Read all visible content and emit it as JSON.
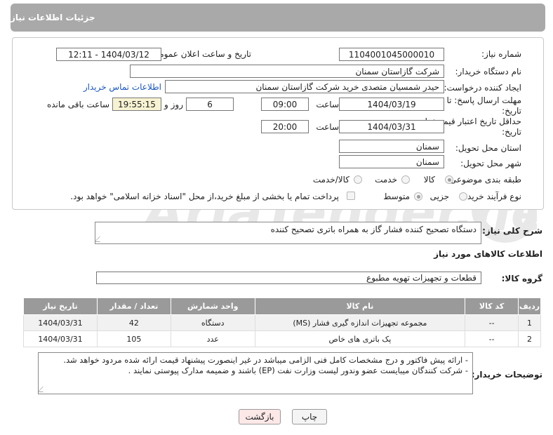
{
  "header": {
    "title": "جزئیات اطلاعات نیاز"
  },
  "form": {
    "need_number_label": "شماره نیاز:",
    "need_number": "1104001045000010",
    "announce_label": "تاریخ و ساعت اعلان عمومی:",
    "announce_value": "1404/03/12 - 12:11",
    "buyer_org_label": "نام دستگاه خریدار:",
    "buyer_org": "شرکت گازاستان سمنان",
    "requester_label": "ایجاد کننده درخواست:",
    "requester": "حیدر شمسیان متصدی خرید شرکت گازاستان سمنان",
    "contact_link": "اطلاعات تماس خریدار",
    "send_deadline_label": "مهلت ارسال پاسخ: تا تاریخ:",
    "send_date": "1404/03/19",
    "time_label": "ساعت",
    "send_time": "09:00",
    "days_value": "6",
    "days_label": "روز و",
    "remaining_time": "19:55:15",
    "remaining_label": "ساعت باقی مانده",
    "price_validity_label": "حداقل تاریخ اعتبار قیمت: تا تاریخ:",
    "price_date": "1404/03/31",
    "price_time": "20:00",
    "province_label": "استان محل تحویل:",
    "province": "سمنان",
    "city_label": "شهر محل تحویل:",
    "city": "سمنان",
    "category_label": "طبقه بندی موضوعی:",
    "category_options": [
      "کالا",
      "خدمت",
      "کالا/خدمت"
    ],
    "process_label": "نوع فرآیند خرید :",
    "process_options": [
      "جزیی",
      "متوسط"
    ],
    "payment_note": "پرداخت تمام یا بخشی از مبلغ خرید،از محل \"اسناد خزانه اسلامی\" خواهد بود."
  },
  "description": {
    "label": "شرح کلی نیاز:",
    "text": "دستگاه تصحیح کننده فشار گاز به همراه باتری تصحیح کننده"
  },
  "goods": {
    "section_title": "اطلاعات کالاهای مورد نیاز",
    "group_label": "گروه کالا:",
    "group_value": "قطعات و تجهیزات تهویه مطبوع",
    "columns": [
      "ردیف",
      "کد کالا",
      "نام کالا",
      "واحد شمارش",
      "تعداد / مقدار",
      "تاریخ نیاز"
    ],
    "rows": [
      {
        "idx": "1",
        "code": "--",
        "name": "مجموعه تجهیزات اندازه گیری فشار (MS)",
        "unit": "دستگاه",
        "qty": "42",
        "date": "1404/03/31"
      },
      {
        "idx": "2",
        "code": "--",
        "name": "پک باتری های خاص",
        "unit": "عدد",
        "qty": "105",
        "date": "1404/03/31"
      }
    ]
  },
  "buyer_notes": {
    "label": "توضیحات خریدار:",
    "line1": "- ارائه پیش فاکتور و درج مشخصات کامل فنی الزامی میباشد در غیر اینصورت پیشنهاد قیمت ارائه شده مردود خواهد شد.",
    "line2": "- شرکت کنندگان میبایست عضو وندور لیست وزارت نفت (EP) باشند و ضمیمه مدارک پیوستی نمایند ."
  },
  "buttons": {
    "print": "چاپ",
    "back": "بازگشت"
  },
  "watermark": {
    "text": "AriaTender.neT"
  },
  "colors": {
    "header_bg": "#a9a9a9",
    "table_header_bg": "#9a9a9a",
    "back_button_bg": "#fde8e8",
    "link": "#1a56c4"
  }
}
